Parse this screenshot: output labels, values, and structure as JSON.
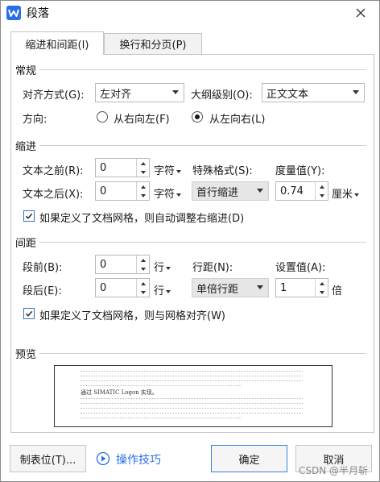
{
  "window": {
    "title": "段落",
    "close_icon": "close-icon",
    "app_icon": "wps-writer-icon",
    "accent": "#2a70e8"
  },
  "tabs": [
    {
      "label": "缩进和间距(I)",
      "active": true
    },
    {
      "label": "换行和分页(P)",
      "active": false
    }
  ],
  "general": {
    "title": "常规",
    "alignment_label": "对齐方式(G):",
    "alignment_value": "左对齐",
    "outline_label": "大纲级别(O):",
    "outline_value": "正文文本",
    "direction_label": "方向:",
    "direction_rtl": "从右向左(F)",
    "direction_ltr": "从左向右(L)",
    "direction_selected": "从左向右(L)"
  },
  "indent": {
    "title": "缩进",
    "before_label": "文本之前(R):",
    "before_value": "0",
    "before_unit": "字符",
    "after_label": "文本之后(X):",
    "after_value": "0",
    "after_unit": "字符",
    "special_label": "特殊格式(S):",
    "special_value": "首行缩进",
    "measure_label": "度量值(Y):",
    "measure_value": "0.74",
    "measure_unit": "厘米",
    "auto_adjust_label": "如果定义了文档网格，则自动调整右缩进(D)",
    "auto_adjust_checked": true
  },
  "spacing": {
    "title": "间距",
    "before_label": "段前(B):",
    "before_value": "0",
    "before_unit": "行",
    "after_label": "段后(E):",
    "after_value": "0",
    "after_unit": "行",
    "line_label": "行距(N):",
    "line_value": "单倍行距",
    "setting_label": "设置值(A):",
    "setting_value": "1",
    "setting_unit": "倍",
    "snap_grid_label": "如果定义了文档网格，则与网格对齐(W)",
    "snap_grid_checked": true
  },
  "preview": {
    "title": "预览",
    "sample_text": "通过 SIMATIC Logon 实现。"
  },
  "buttons": {
    "tabs_label": "制表位(T)...",
    "tips_label": "操作技巧",
    "tips_icon": "play-circle-icon",
    "ok_label": "确定",
    "cancel_label": "取消"
  },
  "watermark": "CSDN @半月斩"
}
